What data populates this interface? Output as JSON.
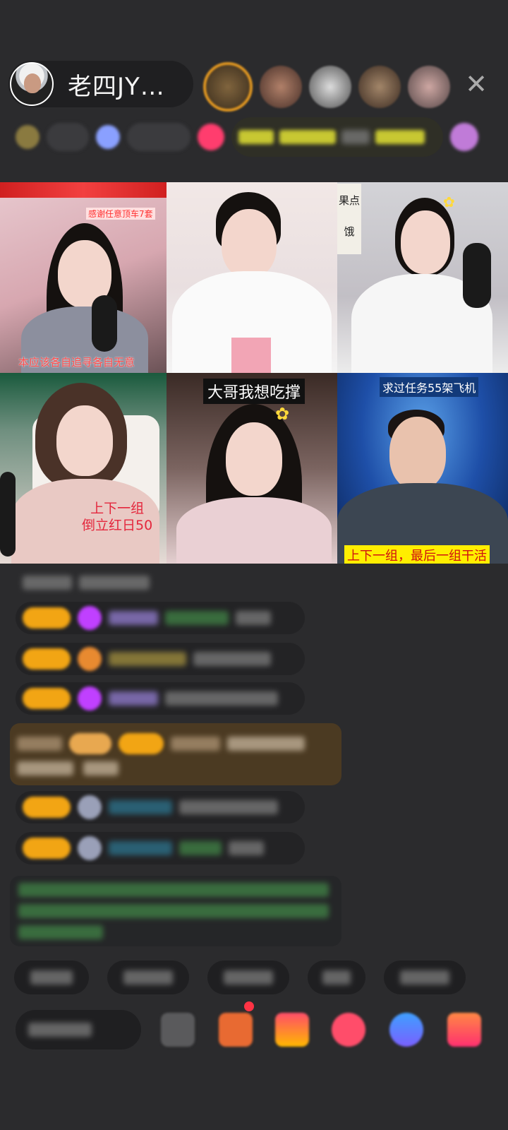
{
  "host": {
    "name": "老四JY…"
  },
  "controls": {
    "close_glyph": "✕"
  },
  "videos": {
    "tile1": {
      "top_caption": "感谢任意顶车7套",
      "bottom_caption": "本应该各自追寻各自无意"
    },
    "tile3": {
      "corner_text": "果点 饿"
    },
    "tile4": {
      "caption_line1": "上下一组",
      "caption_line2": "倒立红日50"
    },
    "tile5": {
      "banner": "大哥我想吃撑"
    },
    "tile6": {
      "top_banner": "求过任务55架飞机",
      "bottom_caption": "上下一组，最后一组干活"
    }
  },
  "colors": {
    "background": "#2b2b2d",
    "badge_orange": "#f2a514",
    "notification_red": "#ff3344"
  }
}
